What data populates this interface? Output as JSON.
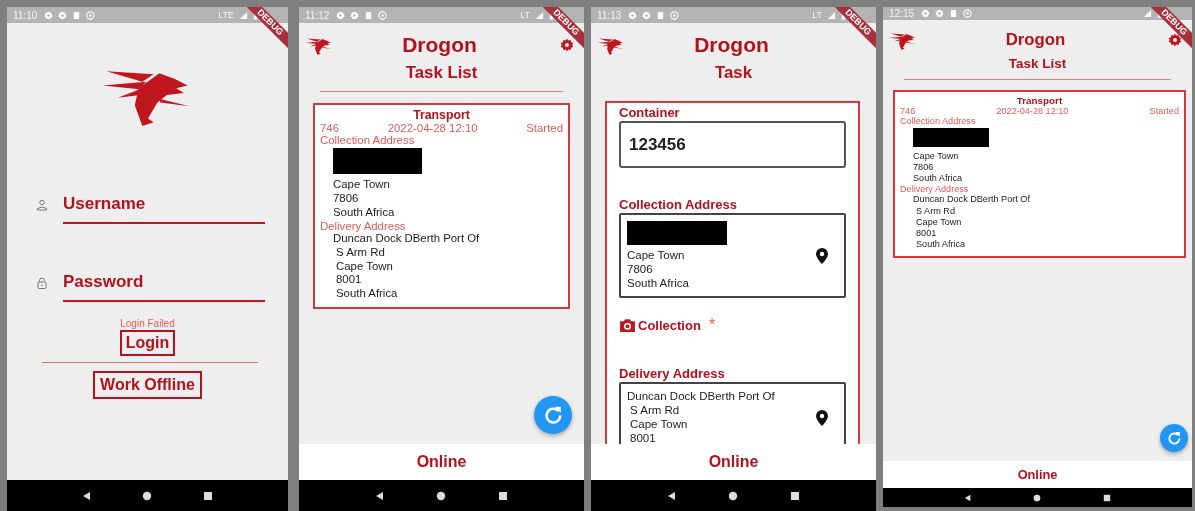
{
  "screens": [
    {
      "kind": "login",
      "status": {
        "time": "11:10",
        "network": "LTE"
      },
      "debug_banner": "DEBUG",
      "username": {
        "placeholder": "Username"
      },
      "password": {
        "placeholder": "Password"
      },
      "error": "Login Failed",
      "buttons": [
        "Login",
        "Work Offline"
      ]
    },
    {
      "kind": "task_list",
      "status": {
        "time": "11:12",
        "network": "LT"
      },
      "debug_banner": "DEBUG",
      "app_title": "Drogon",
      "settings": true,
      "page_title": "Task List",
      "tasks": [
        {
          "type": "Transport",
          "number": "746",
          "date": "2022-04-28 12:10",
          "status": "Started",
          "collection_label": "Collection Address",
          "collection_lines": [
            "Cape Town",
            "7806",
            "South Africa"
          ],
          "delivery_label": "Delivery Address",
          "delivery_lines": [
            "Duncan Dock DBerth Port Of",
            "S Arm Rd",
            "Cape Town",
            "8001",
            "South Africa"
          ]
        }
      ],
      "refresh_button": true,
      "footer": "Online"
    },
    {
      "kind": "task",
      "status": {
        "time": "11:13",
        "network": "LT"
      },
      "debug_banner": "DEBUG",
      "app_title": "Drogon",
      "page_title": "Task",
      "form": {
        "container": {
          "label": "Container",
          "value": "123456"
        },
        "collection": {
          "label": "Collection Address",
          "lines": [
            "Cape Town",
            "7806",
            "South Africa"
          ]
        },
        "photo": {
          "label": "Collection",
          "marker": "*"
        },
        "delivery": {
          "label": "Delivery Address",
          "lines": [
            "Duncan Dock DBerth Port Of",
            "S Arm Rd",
            "Cape Town",
            "8001"
          ]
        }
      },
      "footer": "Online"
    },
    {
      "kind": "task_list",
      "status": {
        "time": "12:15"
      },
      "debug_banner": "DEBUG",
      "app_title": "Drogon",
      "settings": true,
      "page_title": "Task List",
      "tasks": [
        {
          "type": "Transport",
          "number": "746",
          "date": "2022-04-28 12:10",
          "status": "Started",
          "collection_label": "Collection Address",
          "collection_lines": [
            "Cape Town",
            "7806",
            "South Africa"
          ],
          "delivery_label": "Delivery Address",
          "delivery_lines": [
            "Duncan Dock DBerth Port Of",
            "S Arm Rd",
            "Cape Town",
            "8001",
            "South Africa"
          ]
        }
      ],
      "refresh_button": true,
      "footer": "Online"
    }
  ]
}
